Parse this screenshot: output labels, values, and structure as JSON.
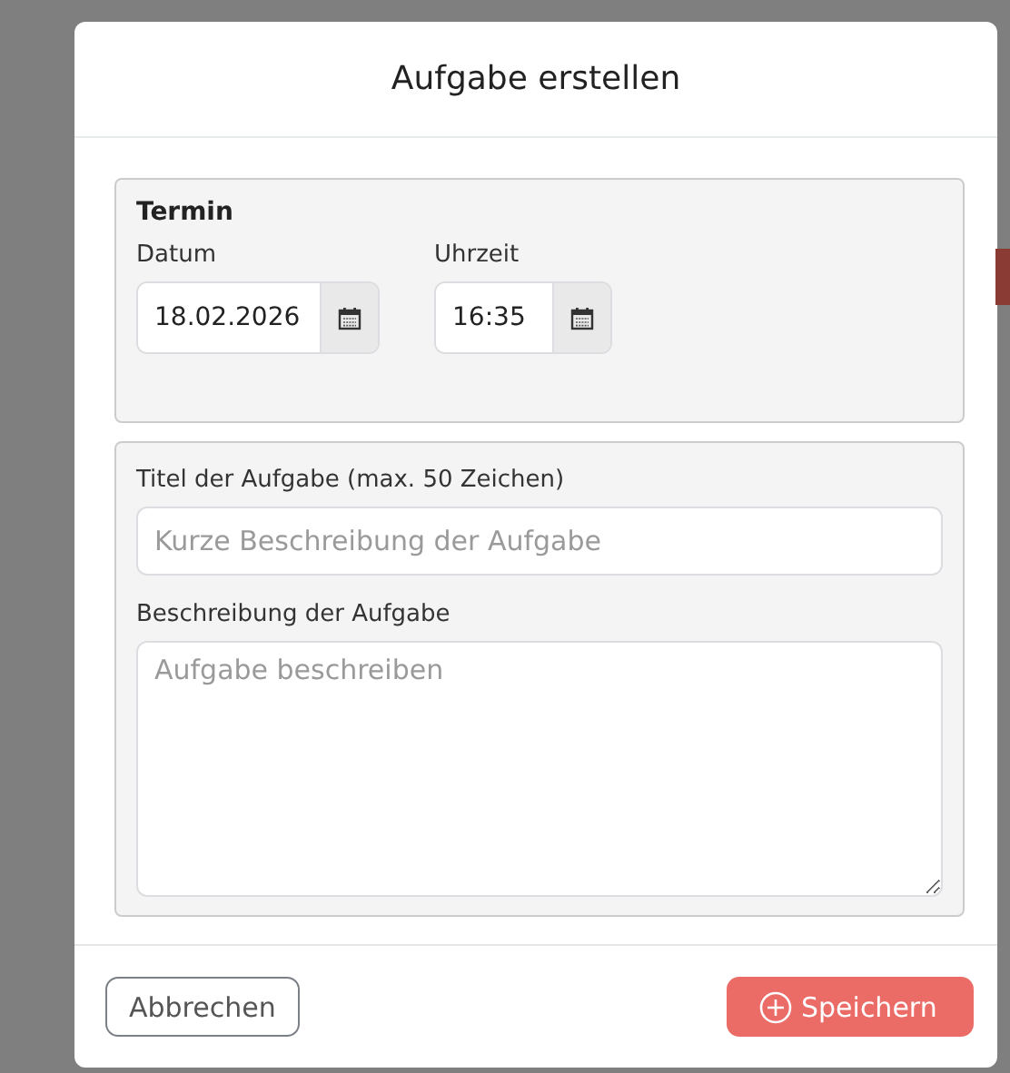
{
  "dialog": {
    "title": "Aufgabe erstellen"
  },
  "appointment": {
    "heading": "Termin",
    "date": {
      "label": "Datum",
      "value": "18.02.2026"
    },
    "time": {
      "label": "Uhrzeit",
      "value": "16:35"
    }
  },
  "task": {
    "title_label": "Titel der Aufgabe (max. 50 Zeichen)",
    "title_placeholder": "Kurze Beschreibung der Aufgabe",
    "description_label": "Beschreibung der Aufgabe",
    "description_placeholder": "Aufgabe beschreiben"
  },
  "buttons": [
    {
      "label": "Abbrechen",
      "kind": "secondary"
    },
    {
      "label": "Speichern",
      "kind": "primary"
    }
  ]
}
